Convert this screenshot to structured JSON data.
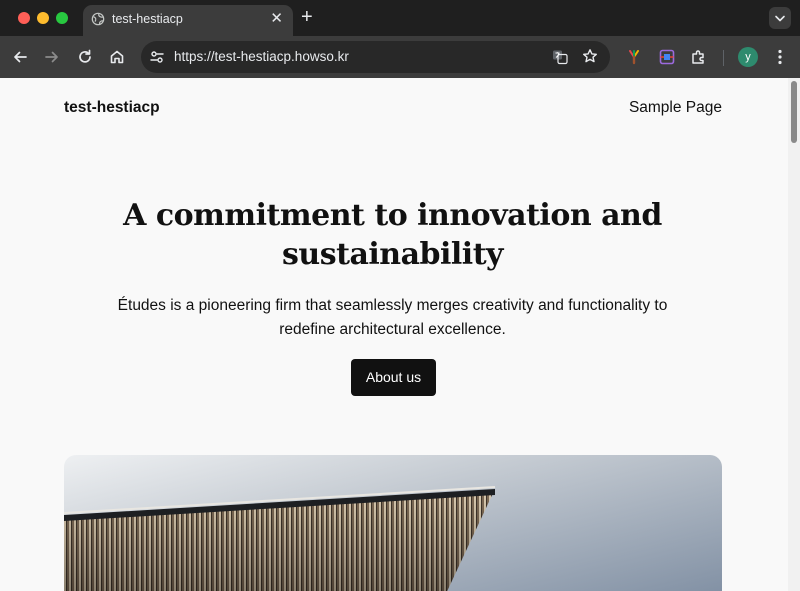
{
  "browser": {
    "tab": {
      "title": "test-hestiacp"
    },
    "address_bar": {
      "url": "https://test-hestiacp.howso.kr"
    },
    "profile_initial": "y"
  },
  "site": {
    "title": "test-hestiacp",
    "nav": {
      "sample_page": "Sample Page"
    }
  },
  "hero": {
    "heading": "A commitment to innovation and sustainability",
    "text": "Études is a pioneering firm that seamlessly merges creativity and functionality to redefine architectural excellence.",
    "button_label": "About us"
  },
  "colors": {
    "page_background": "#f9f9f9",
    "button_background": "#111111",
    "browser_frame": "#1f1f1f",
    "toolbar": "#3c3c3c"
  }
}
